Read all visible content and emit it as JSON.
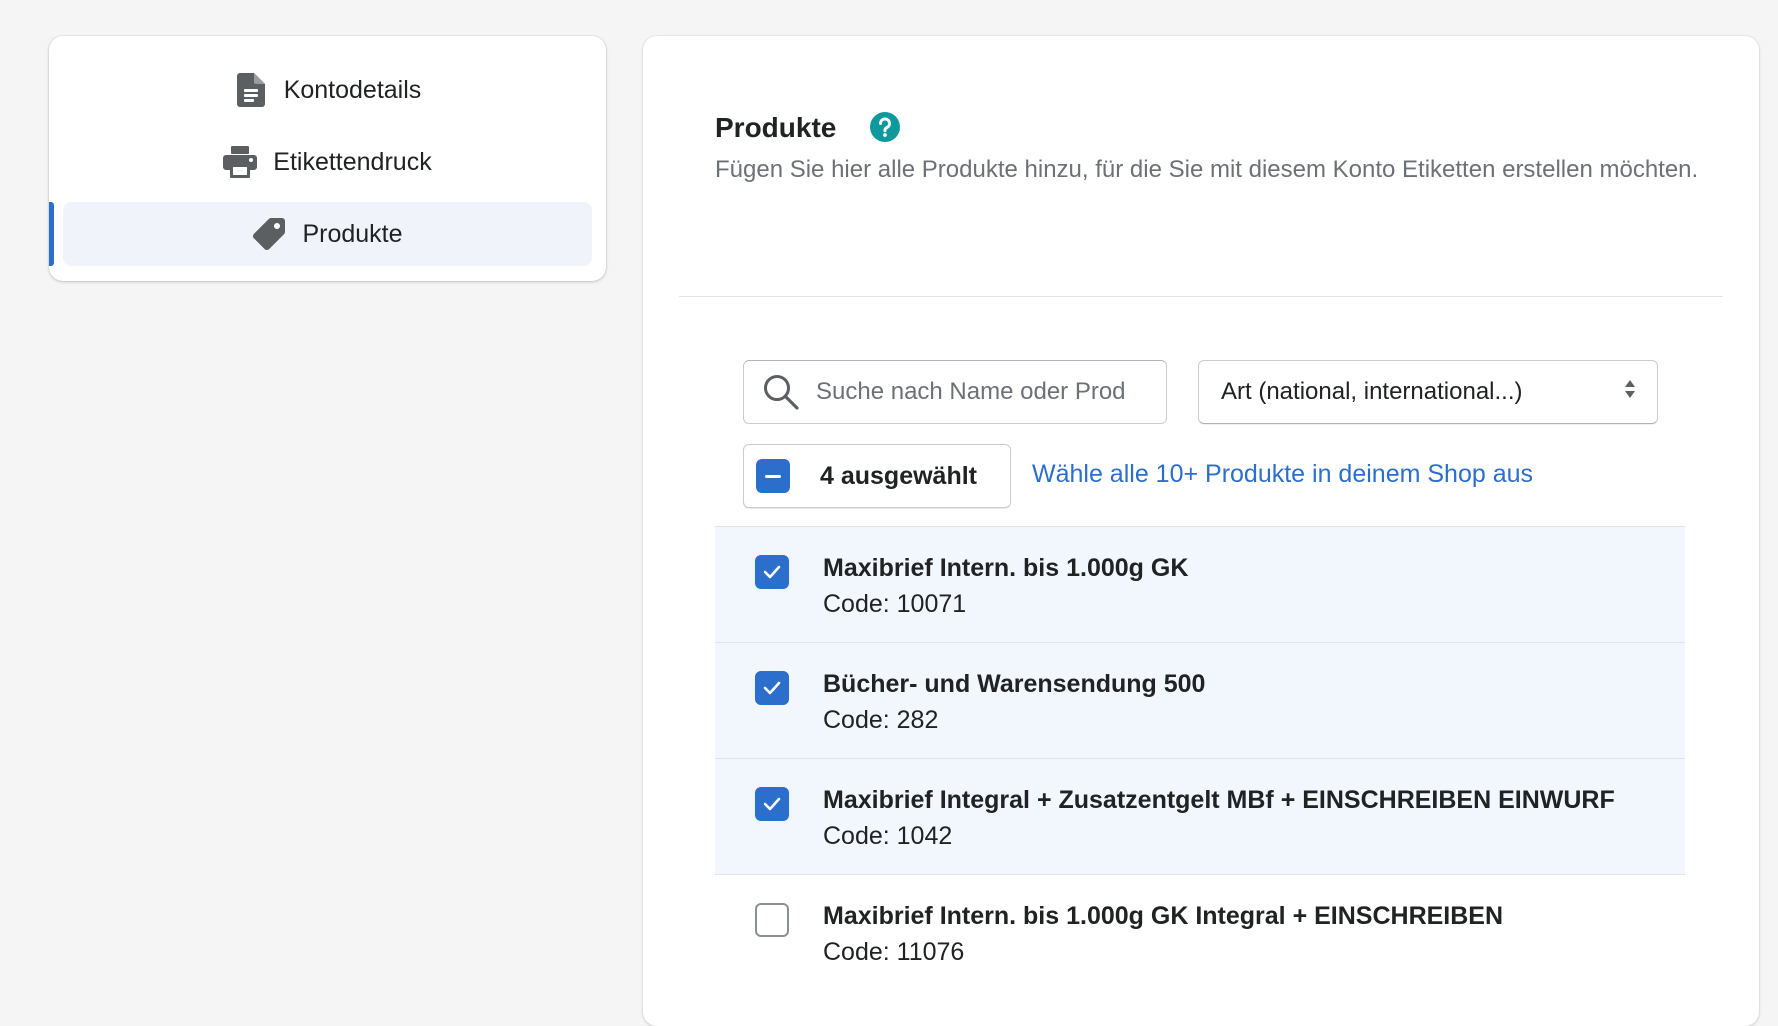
{
  "sidebar": {
    "items": [
      {
        "label": "Kontodetails",
        "icon": "document-icon",
        "active": false
      },
      {
        "label": "Etikettendruck",
        "icon": "printer-icon",
        "active": false
      },
      {
        "label": "Produkte",
        "icon": "tag-icon",
        "active": true
      }
    ]
  },
  "section": {
    "title": "Produkte",
    "help_icon": "question-circle-icon",
    "description": "Fügen Sie hier alle Produkte hinzu, für die Sie mit diesem Konto Etiketten erstellen möchten."
  },
  "filters": {
    "search_placeholder": "Suche nach Name oder Produkt-Code",
    "search_value": "",
    "type_select": "Art (national, international...)"
  },
  "bulk": {
    "selected_label": "4 ausgewählt",
    "select_all_link": "Wähle alle 10+ Produkte in deinem Shop aus"
  },
  "products": [
    {
      "name": "Maxibrief Intern. bis 1.000g GK",
      "code": "Code: 10071",
      "checked": true
    },
    {
      "name": "Bücher- und Warensendung 500",
      "code": "Code: 282",
      "checked": true
    },
    {
      "name": "Maxibrief Integral + Zusatzentgelt MBf + EINSCHREIBEN EINWURF",
      "code": "Code: 1042",
      "checked": true
    },
    {
      "name": "Maxibrief Intern. bis 1.000g GK Integral + EINSCHREIBEN",
      "code": "Code: 11076",
      "checked": false
    }
  ],
  "colors": {
    "accent": "#2c6ecb",
    "help": "#0e9a9c",
    "selected_row": "#f2f7fe",
    "background": "#f5f5f5"
  }
}
